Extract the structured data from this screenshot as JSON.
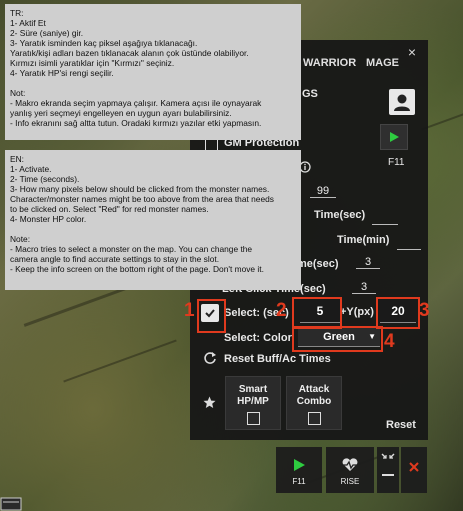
{
  "panel": {
    "close_symbol": "×",
    "tabs": [
      "WARRIOR",
      "MAGE"
    ],
    "partial_heading": "GS",
    "play_icon": "play-icon",
    "play_hotkey": "F11",
    "gm_protection_label": "GM Protection",
    "field_value_99": "99",
    "time_sec_label_1": "Time(sec)",
    "time_min_label": "Time(min)",
    "time_sec_label_2_partial": "me(sec)",
    "field_value_3a": "3",
    "left_click_label_partial": "Left Click  Time(sec)",
    "field_value_3b": "3",
    "select_label": "Select: (sec)",
    "select_value": "5",
    "y_px_label": "+Y(px)",
    "y_px_value": "20",
    "select_color_label": "Select: Color",
    "select_color_value": "Green",
    "reset_buff_label": "Reset Buff/Ac Times",
    "smart_hp_mp_label": "Smart HP/MP",
    "attack_combo_label": "Attack Combo",
    "reset_label": "Reset",
    "accent_red": "#e03a1e",
    "annotation_numbers": [
      "1",
      "2",
      "3",
      "4"
    ]
  },
  "info_tr": {
    "lines": [
      "TR:",
      "1- Aktif Et",
      "2- Süre (saniye) gir.",
      "3- Yaratık isminden kaç piksel aşağıya tıklanacağı.",
      "Yaratık/kişi adları bazen tıklanacak alanın çok üstünde olabiliyor.",
      "Kırmızı isimli yaratıklar için \"Kırmızı\" seçiniz.",
      "4- Yaratık HP'si rengi seçilir.",
      "",
      "Not:",
      "- Makro ekranda seçim yapmaya çalışır. Kamera açısı ile oynayarak",
      "yanlış yeri seçmeyi engelleyen en uygun ayarı bulabilirsiniz.",
      "- Info ekranını sağ altta tutun. Oradaki kırmızı yazılar etki yapmasın."
    ]
  },
  "info_en": {
    "lines": [
      "EN:",
      "1- Activate.",
      "2- Time (seconds).",
      "3- How many pixels below should be clicked from the monster names.",
      "Character/monster names might be too above from the area that needs",
      "to be clicked on. Select \"Red\" for red monster names.",
      "4- Monster HP color.",
      "",
      "Note:",
      "- Macro tries to select a monster on the map. You can change the",
      "camera angle to find accurate settings to stay in the slot.",
      "- Keep the info screen on the bottom right of the page. Don't move it."
    ]
  },
  "toolbar": {
    "play_label": "F11",
    "rise_label": "RISE",
    "heart_icon": "heart-pulse-icon",
    "compress_icon": "compress-icon",
    "close_icon": "close-icon"
  }
}
